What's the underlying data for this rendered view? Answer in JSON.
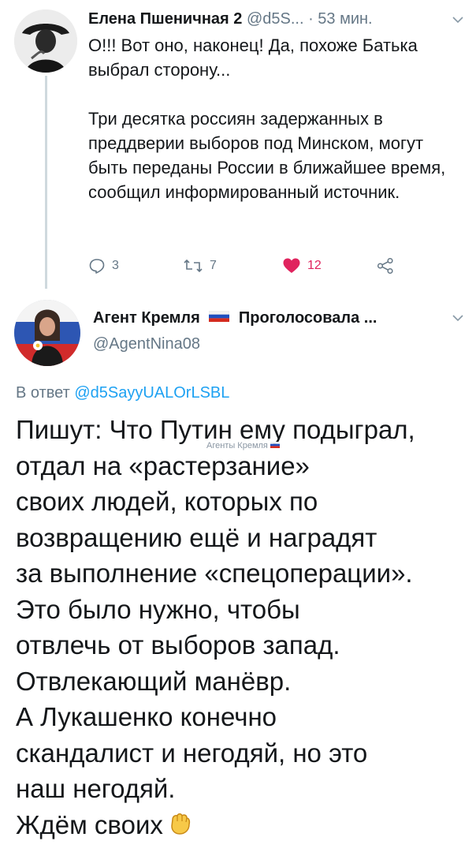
{
  "tweet1": {
    "author_name": "Елена Пшеничная 2",
    "handle": "@d5S...",
    "time": "· 53 мин.",
    "body": [
      "О!!! Вот оно, наконец! Да, похоже Батька выбрал сторону...",
      "Три десятка россиян задержанных в преддверии выборов под Минском, могут быть переданы России в ближайшее время, сообщил информированный источник."
    ],
    "replies": "3",
    "retweets": "7",
    "likes": "12"
  },
  "tweet2": {
    "author_name": "Агент Кремля",
    "name_suffix": "Проголосовала ...",
    "handle": "@AgentNina08",
    "reply_prefix": "В ответ",
    "reply_to": "@d5SayyUALOrLSBL",
    "body_lines": [
      "Пишут: Что Путин ему подыграл,",
      "отдал на «растерзание»",
      "своих людей, которых по",
      "возвращению ещё и наградят",
      "за выполнение «спецоперации».",
      "Это было нужно, чтобы",
      "отвлечь от выборов запад.",
      "Отвлекающий манёвр.",
      "А Лукашенко конечно",
      "скандалист и негодяй, но это",
      "наш негодяй.",
      "Ждём своих"
    ],
    "watermark": "Агенты Кремля"
  },
  "icons": [
    "reply-icon",
    "retweet-icon",
    "heart-icon",
    "share-icon",
    "chevron-down-icon",
    "russian-flag-icon",
    "raised-fist-icon"
  ],
  "colors": {
    "link": "#1da1f2",
    "meta": "#657786",
    "like": "#e0245e",
    "thread_line": "#cfd9de"
  }
}
